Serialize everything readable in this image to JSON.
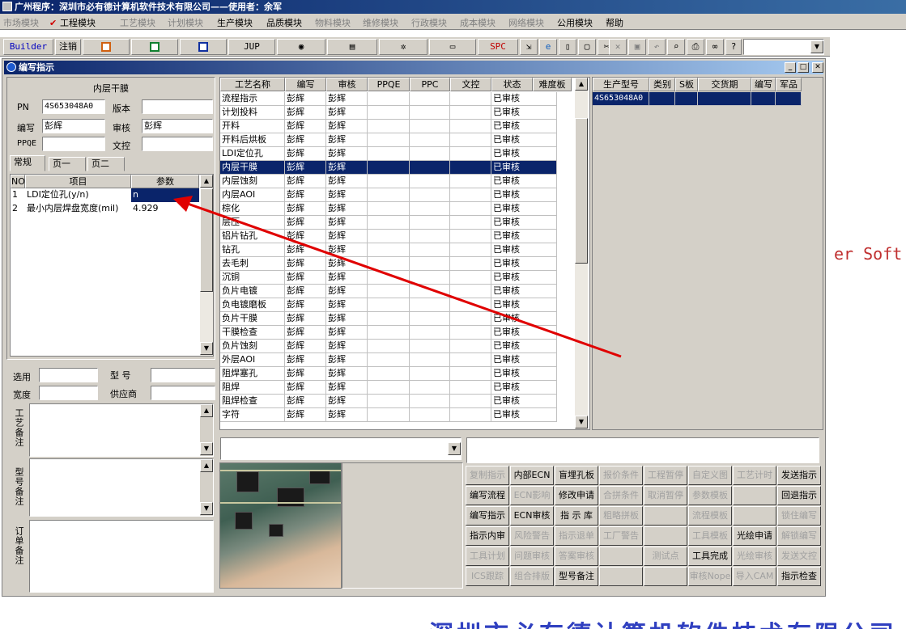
{
  "app": {
    "title": "广州程序：深圳市必有德计算机软件技术有限公司——使用者：余军"
  },
  "menu": [
    {
      "label": "市场模块",
      "enabled": false
    },
    {
      "label": "工程模块",
      "enabled": true,
      "checked": true
    },
    {
      "label": "工艺模块",
      "enabled": false
    },
    {
      "label": "计划模块",
      "enabled": false
    },
    {
      "label": "生产模块",
      "enabled": true
    },
    {
      "label": "品质模块",
      "enabled": true
    },
    {
      "label": "物料模块",
      "enabled": false
    },
    {
      "label": "维修模块",
      "enabled": false
    },
    {
      "label": "行政模块",
      "enabled": false
    },
    {
      "label": "成本模块",
      "enabled": false
    },
    {
      "label": "网络模块",
      "enabled": false
    },
    {
      "label": "公用模块",
      "enabled": true
    },
    {
      "label": "帮助",
      "enabled": true
    }
  ],
  "toolbar": {
    "builder": "Builder",
    "logout": "注销",
    "jup": "JUP",
    "spc": "SPC"
  },
  "window": {
    "title": "编写指示"
  },
  "form": {
    "section_title": "内层干膜",
    "pn_label": "PN",
    "pn_value": "4S653048A0",
    "version_label": "版本",
    "version_value": "",
    "writer_label": "编写",
    "writer_value": "彭辉",
    "reviewer_label": "审核",
    "reviewer_value": "彭辉",
    "ppqe_label": "PPQE",
    "ppqe_value": "",
    "doc_label": "文控",
    "doc_value": "",
    "tabs": [
      "常规",
      "页一",
      "页二"
    ],
    "param_headers": [
      "NO",
      "项目",
      "参数"
    ],
    "params": [
      {
        "no": "1",
        "item": "LDI定位孔(y/n)",
        "value": "n"
      },
      {
        "no": "2",
        "item": "最小内层焊盘宽度(mil)",
        "value": "4.929"
      }
    ],
    "select_label": "选用",
    "model_label": "型  号",
    "width_label": "宽度",
    "supplier_label": "供应商",
    "notes": [
      "工艺备注",
      "型号备注",
      "订单备注"
    ]
  },
  "process": {
    "headers": [
      "工艺名称",
      "编写",
      "审核",
      "PPQE",
      "PPC",
      "文控",
      "状态",
      "难度板"
    ],
    "rows": [
      [
        "流程指示",
        "彭辉",
        "彭辉",
        "",
        "",
        "",
        "已审核",
        ""
      ],
      [
        "计划投料",
        "彭辉",
        "彭辉",
        "",
        "",
        "",
        "已审核",
        ""
      ],
      [
        "开料",
        "彭辉",
        "彭辉",
        "",
        "",
        "",
        "已审核",
        ""
      ],
      [
        "开料后烘板",
        "彭辉",
        "彭辉",
        "",
        "",
        "",
        "已审核",
        ""
      ],
      [
        "LDI定位孔",
        "彭辉",
        "彭辉",
        "",
        "",
        "",
        "已审核",
        ""
      ],
      [
        "内层干膜",
        "彭辉",
        "彭辉",
        "",
        "",
        "",
        "已审核",
        ""
      ],
      [
        "内层蚀刻",
        "彭辉",
        "彭辉",
        "",
        "",
        "",
        "已审核",
        ""
      ],
      [
        "内层AOI",
        "彭辉",
        "彭辉",
        "",
        "",
        "",
        "已审核",
        ""
      ],
      [
        "棕化",
        "彭辉",
        "彭辉",
        "",
        "",
        "",
        "已审核",
        ""
      ],
      [
        "层压",
        "彭辉",
        "彭辉",
        "",
        "",
        "",
        "已审核",
        ""
      ],
      [
        "铝片钻孔",
        "彭辉",
        "彭辉",
        "",
        "",
        "",
        "已审核",
        ""
      ],
      [
        "钻孔",
        "彭辉",
        "彭辉",
        "",
        "",
        "",
        "已审核",
        ""
      ],
      [
        "去毛刺",
        "彭辉",
        "彭辉",
        "",
        "",
        "",
        "已审核",
        ""
      ],
      [
        "沉铜",
        "彭辉",
        "彭辉",
        "",
        "",
        "",
        "已审核",
        ""
      ],
      [
        "负片电镀",
        "彭辉",
        "彭辉",
        "",
        "",
        "",
        "已审核",
        ""
      ],
      [
        "负电镀磨板",
        "彭辉",
        "彭辉",
        "",
        "",
        "",
        "已审核",
        ""
      ],
      [
        "负片干膜",
        "彭辉",
        "彭辉",
        "",
        "",
        "",
        "已审核",
        ""
      ],
      [
        "干膜检查",
        "彭辉",
        "彭辉",
        "",
        "",
        "",
        "已审核",
        ""
      ],
      [
        "负片蚀刻",
        "彭辉",
        "彭辉",
        "",
        "",
        "",
        "已审核",
        ""
      ],
      [
        "外层AOI",
        "彭辉",
        "彭辉",
        "",
        "",
        "",
        "已审核",
        ""
      ],
      [
        "阻焊塞孔",
        "彭辉",
        "彭辉",
        "",
        "",
        "",
        "已审核",
        ""
      ],
      [
        "阻焊",
        "彭辉",
        "彭辉",
        "",
        "",
        "",
        "已审核",
        ""
      ],
      [
        "阻焊检查",
        "彭辉",
        "彭辉",
        "",
        "",
        "",
        "已审核",
        ""
      ],
      [
        "字符",
        "彭辉",
        "彭辉",
        "",
        "",
        "",
        "已审核",
        ""
      ]
    ],
    "selected_row": 5
  },
  "products": {
    "headers": [
      "生产型号",
      "类别",
      "S板",
      "交货期",
      "编写",
      "军品"
    ],
    "rows": [
      [
        "4S653048A0",
        "",
        "",
        "",
        "",
        ""
      ]
    ]
  },
  "actions": [
    [
      {
        "label": "复制指示",
        "enabled": false
      },
      {
        "label": "内部ECN",
        "enabled": true
      },
      {
        "label": "盲埋孔板",
        "enabled": true
      },
      {
        "label": "报价条件",
        "enabled": false
      },
      {
        "label": "工程暂停",
        "enabled": false
      },
      {
        "label": "自定义图",
        "enabled": false
      },
      {
        "label": "工艺计时",
        "enabled": false
      },
      {
        "label": "发送指示",
        "enabled": true
      }
    ],
    [
      {
        "label": "编写流程",
        "enabled": true
      },
      {
        "label": "ECN影响",
        "enabled": false
      },
      {
        "label": "修改申请",
        "enabled": true
      },
      {
        "label": "合拼条件",
        "enabled": false
      },
      {
        "label": "取消暂停",
        "enabled": false
      },
      {
        "label": "参数模板",
        "enabled": false
      },
      {
        "label": "",
        "enabled": false
      },
      {
        "label": "回退指示",
        "enabled": true
      }
    ],
    [
      {
        "label": "编写指示",
        "enabled": true
      },
      {
        "label": "ECN审核",
        "enabled": true
      },
      {
        "label": "指 示 库",
        "enabled": true
      },
      {
        "label": "粗略拼板",
        "enabled": false
      },
      {
        "label": "",
        "enabled": false
      },
      {
        "label": "流程模板",
        "enabled": false
      },
      {
        "label": "",
        "enabled": false
      },
      {
        "label": "锁住编写",
        "enabled": false
      }
    ],
    [
      {
        "label": "指示内审",
        "enabled": true
      },
      {
        "label": "风险警告",
        "enabled": false
      },
      {
        "label": "指示退单",
        "enabled": false
      },
      {
        "label": "工厂警告",
        "enabled": false
      },
      {
        "label": "",
        "enabled": false
      },
      {
        "label": "工具模板",
        "enabled": false
      },
      {
        "label": "光绘申请",
        "enabled": true
      },
      {
        "label": "解锁编写",
        "enabled": false
      }
    ],
    [
      {
        "label": "工具计划",
        "enabled": false
      },
      {
        "label": "问题审核",
        "enabled": false
      },
      {
        "label": "答案审核",
        "enabled": false
      },
      {
        "label": "",
        "enabled": false
      },
      {
        "label": "测试点",
        "enabled": false
      },
      {
        "label": "工具完成",
        "enabled": true
      },
      {
        "label": "光绘审核",
        "enabled": false
      },
      {
        "label": "发送文控",
        "enabled": false
      }
    ],
    [
      {
        "label": "ICS跟踪",
        "enabled": false
      },
      {
        "label": "组合排版",
        "enabled": false
      },
      {
        "label": "型号备注",
        "enabled": true
      },
      {
        "label": "",
        "enabled": false
      },
      {
        "label": "",
        "enabled": false
      },
      {
        "label": "审核Nope",
        "enabled": false
      },
      {
        "label": "导入CAM",
        "enabled": false
      },
      {
        "label": "指示检查",
        "enabled": true
      }
    ]
  ],
  "background": {
    "text_right": "er Soft",
    "text_bottom": "深圳市必有德计算机软件技术有限公司"
  },
  "colors": {
    "title_blue": "#0a246a",
    "face": "#d4d0c8",
    "annotation_arrow": "#e00000"
  }
}
